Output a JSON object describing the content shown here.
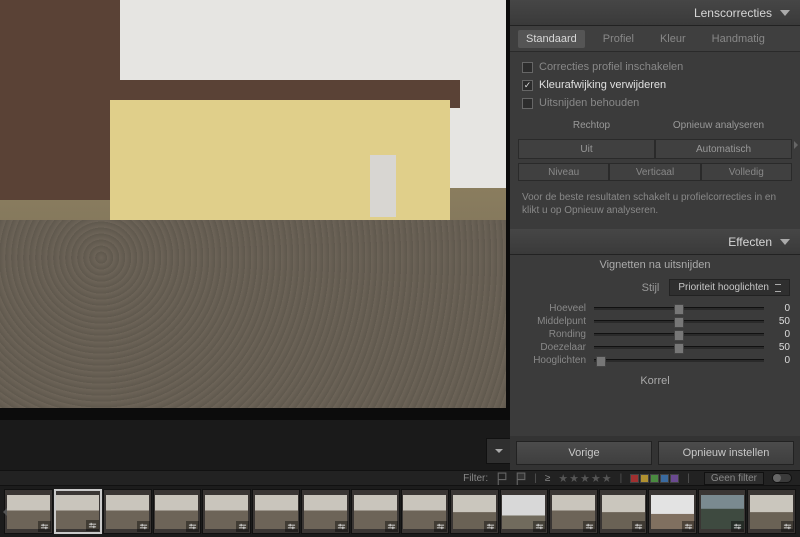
{
  "panels": {
    "lens": {
      "title": "Lenscorrecties",
      "tabs": {
        "standard": "Standaard",
        "profile": "Profiel",
        "color": "Kleur",
        "manual": "Handmatig"
      },
      "checks": {
        "enable_profile": "Correcties profiel inschakelen",
        "remove_ca": "Kleurafwijking verwijderen",
        "constrain_crop": "Uitsnijden behouden"
      },
      "upright": {
        "label": "Rechtop",
        "reanalyze": "Opnieuw analyseren",
        "off": "Uit",
        "auto": "Automatisch",
        "level": "Niveau",
        "vertical": "Verticaal",
        "full": "Volledig"
      },
      "info": "Voor de beste resultaten schakelt u profielcorrecties in en klikt u op Opnieuw analyseren."
    },
    "effects": {
      "title": "Effecten",
      "vignette_header": "Vignetten na uitsnijden",
      "style_label": "Stijl",
      "style_value": "Prioriteit hooglichten",
      "sliders": {
        "amount": {
          "label": "Hoeveel",
          "value": "0",
          "pos": 50
        },
        "midpoint": {
          "label": "Middelpunt",
          "value": "50",
          "pos": 50
        },
        "roundness": {
          "label": "Ronding",
          "value": "0",
          "pos": 50
        },
        "feather": {
          "label": "Doezelaar",
          "value": "50",
          "pos": 50
        },
        "highlights": {
          "label": "Hooglichten",
          "value": "0",
          "pos": 4
        }
      },
      "grain_header": "Korrel"
    }
  },
  "bottom_buttons": {
    "previous": "Vorige",
    "reset": "Opnieuw instellen"
  },
  "filter_bar": {
    "label": "Filter:",
    "gte": "≥",
    "filter_dd": "Geen filter",
    "colors": [
      "#a03030",
      "#b09030",
      "#4a8a40",
      "#3a6aa0",
      "#6a4a90"
    ]
  },
  "filmstrip": {
    "count": 16
  }
}
